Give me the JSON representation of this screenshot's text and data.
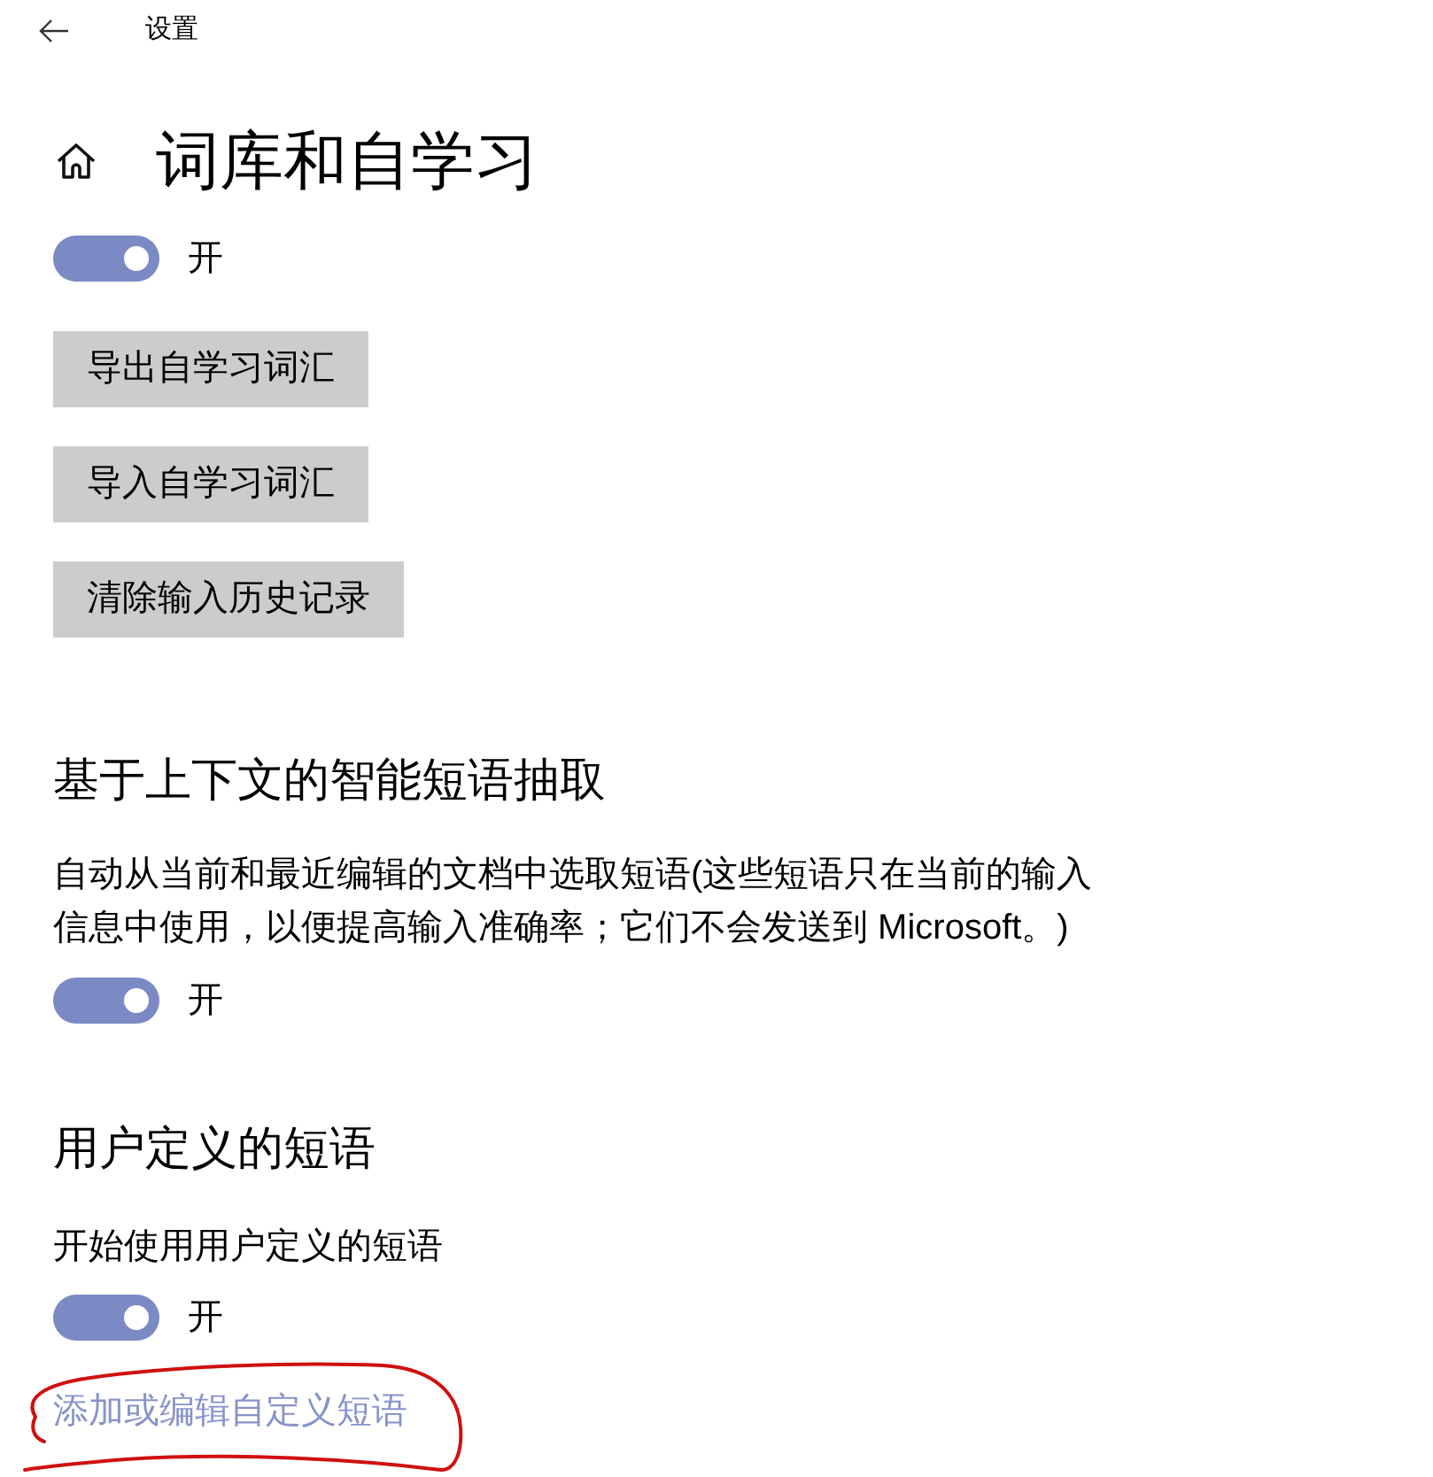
{
  "header": {
    "title": "设置"
  },
  "page": {
    "title": "词库和自学习"
  },
  "blocks": [
    {
      "kind": "toggle",
      "on": true,
      "label": "开"
    },
    {
      "kind": "button",
      "label": "导出自学习词汇"
    },
    {
      "kind": "button",
      "label": "导入自学习词汇"
    },
    {
      "kind": "button",
      "label": "清除输入历史记录"
    },
    {
      "kind": "heading",
      "text": "基于上下文的智能短语抽取"
    },
    {
      "kind": "paragraph",
      "text": "自动从当前和最近编辑的文档中选取短语(这些短语只在当前的输入信息中使用，以便提高输入准确率；它们不会发送到 Microsoft。)"
    },
    {
      "kind": "toggle",
      "on": true,
      "label": "开"
    },
    {
      "kind": "heading",
      "text": "用户定义的短语"
    },
    {
      "kind": "label",
      "text": "开始使用用户定义的短语"
    },
    {
      "kind": "toggle",
      "on": true,
      "label": "开"
    },
    {
      "kind": "link",
      "text": "添加或编辑自定义短语"
    }
  ]
}
